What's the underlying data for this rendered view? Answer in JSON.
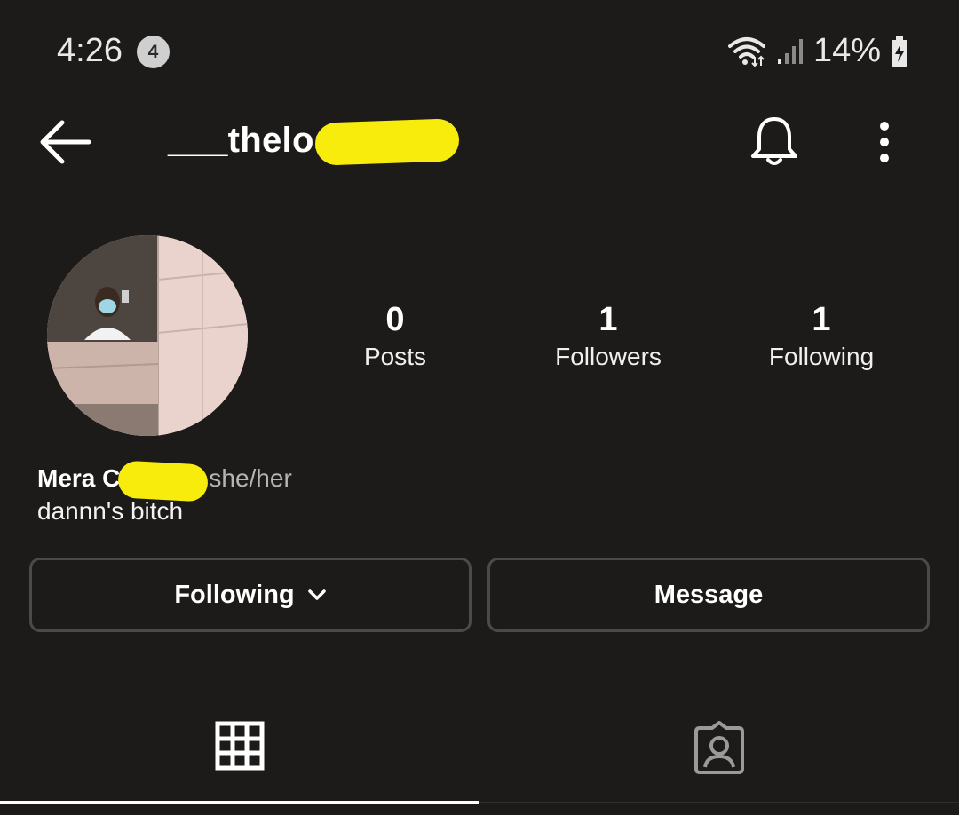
{
  "status_bar": {
    "time": "4:26",
    "notification_count": "4",
    "battery": "14%",
    "icons": [
      "wifi-icon",
      "signal-icon",
      "battery-charging-icon"
    ]
  },
  "header": {
    "username": "___thelos",
    "icons": [
      "back-arrow-icon",
      "bell-icon",
      "more-vertical-icon"
    ]
  },
  "stats": [
    {
      "value": "0",
      "label": "Posts"
    },
    {
      "value": "1",
      "label": "Followers"
    },
    {
      "value": "1",
      "label": "Following"
    }
  ],
  "bio": {
    "name": "Mera C",
    "pronouns": "she/her",
    "text": "dannn's bitch"
  },
  "buttons": {
    "following": "Following",
    "message": "Message"
  },
  "tabs": [
    {
      "icon": "grid-icon",
      "active": true
    },
    {
      "icon": "tagged-icon",
      "active": false
    }
  ],
  "colors": {
    "background": "#1c1b19",
    "text": "#ffffff",
    "muted": "#b5b5b5",
    "border": "#4a4a4a",
    "redaction": "#f7ec0b"
  }
}
